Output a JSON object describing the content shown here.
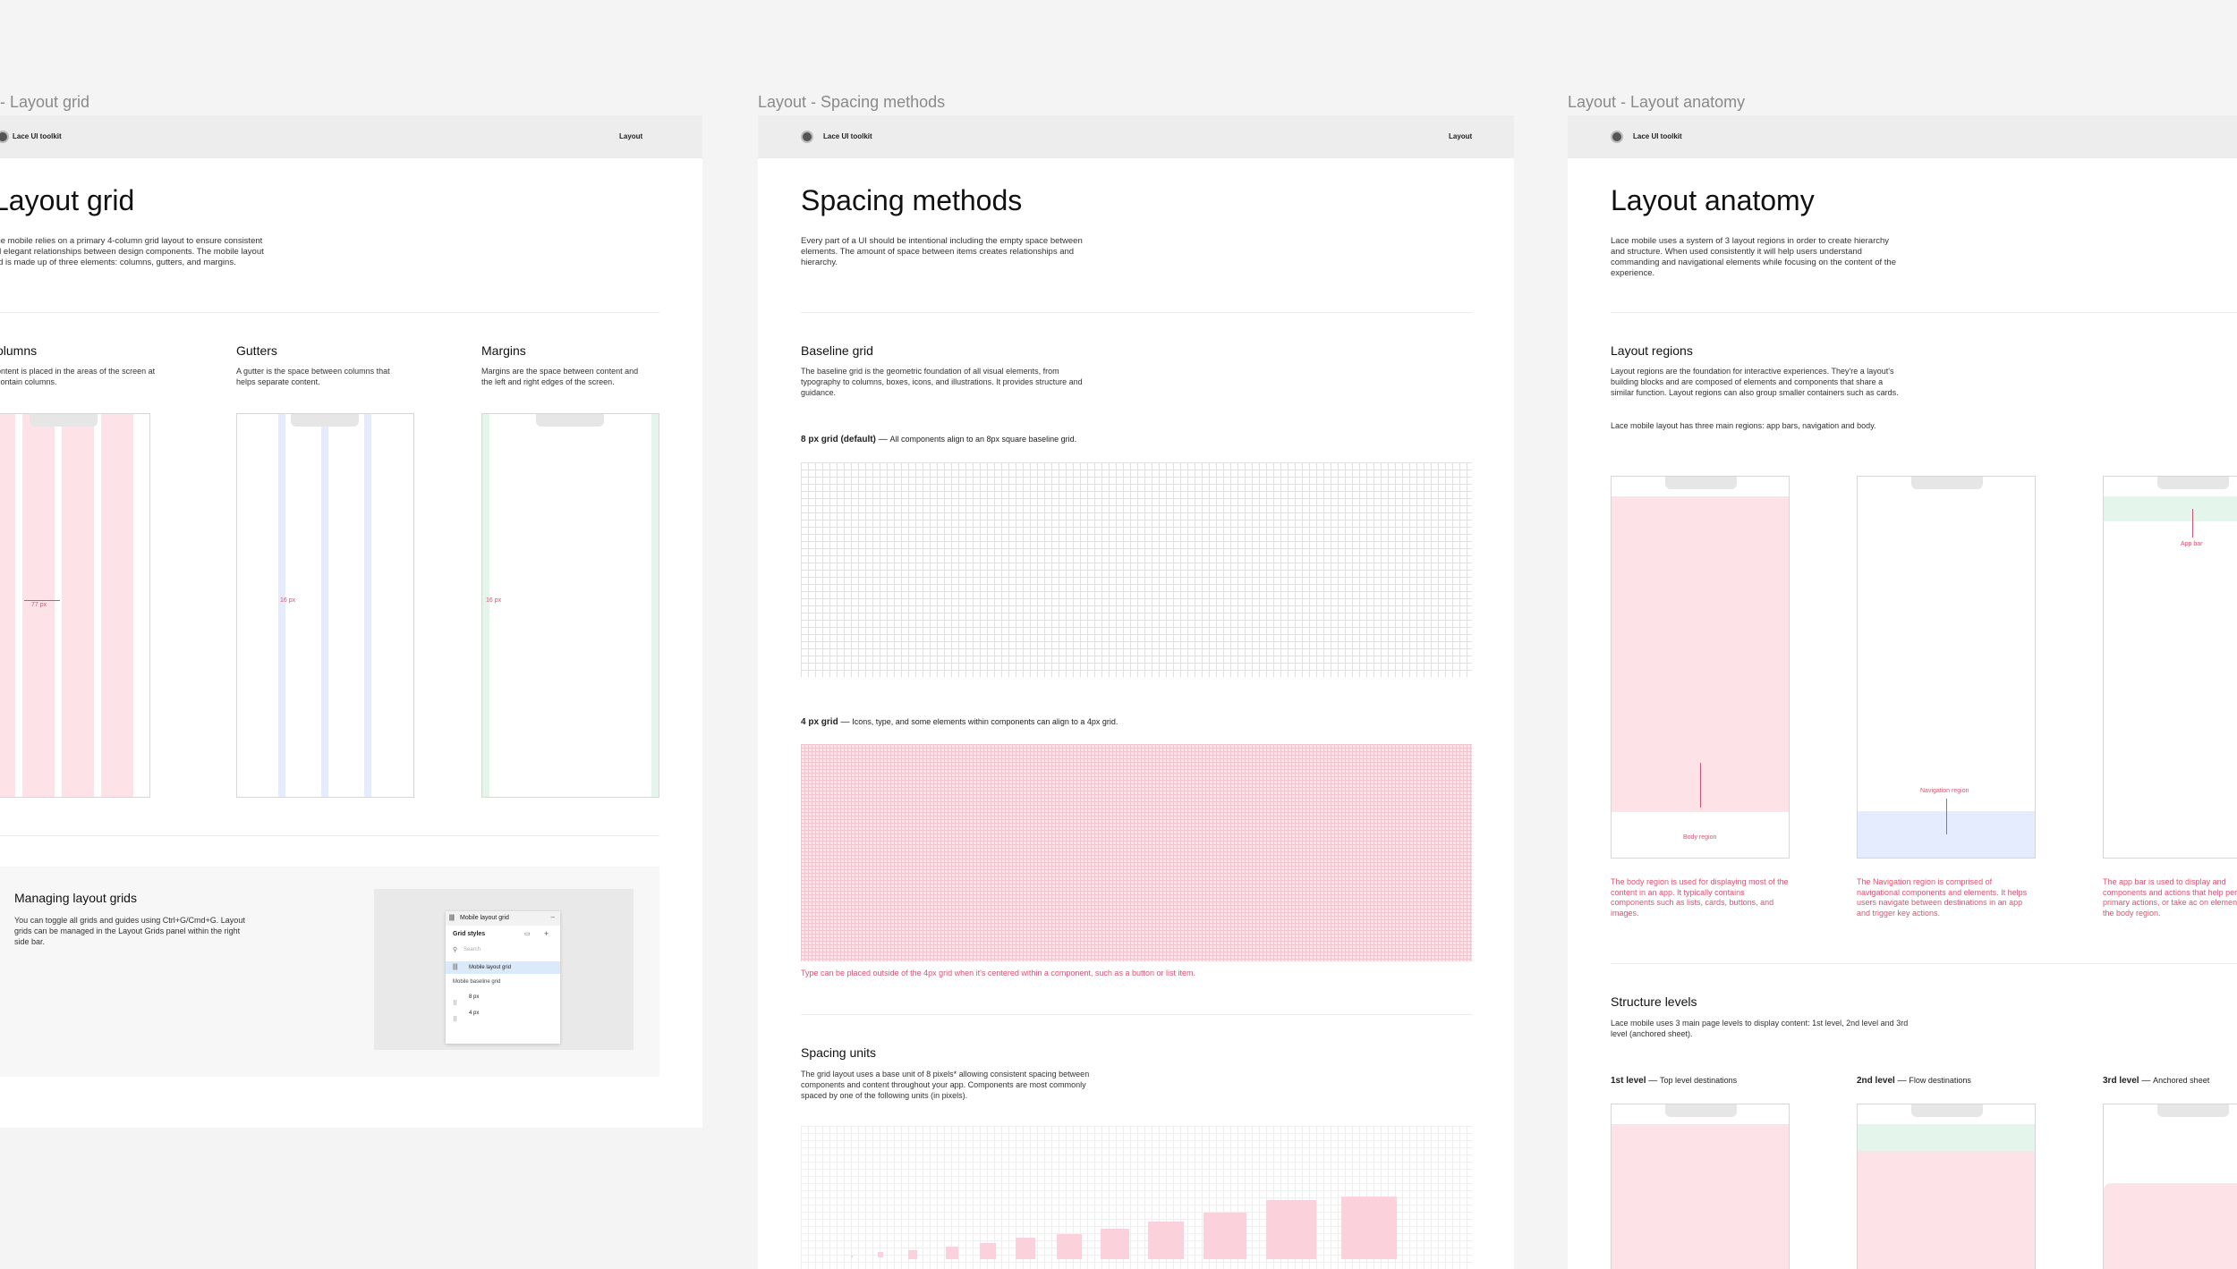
{
  "frames": {
    "layout_grid": {
      "frame_title": "- Layout grid",
      "brand": "Lace UI toolkit",
      "nav": "Layout",
      "title": "Layout grid",
      "intro": "ce mobile relies on a primary 4-column grid layout to ensure consistent d elegant relationships between design components. The mobile layout id is made up of three elements: columns, gutters, and margins.",
      "columns": {
        "heading": "olumns",
        "text": "ontent is placed in the areas of the screen at contain columns.",
        "measure": "77 px"
      },
      "gutters": {
        "heading": "Gutters",
        "text": "A gutter is the space between columns that helps separate content.",
        "measure": "16 px"
      },
      "margins": {
        "heading": "Margins",
        "text": "Margins are the space between content and the left and right edges of the screen.",
        "measure": "16 px"
      },
      "managing": {
        "heading": "Managing layout grids",
        "text": "You can toggle all grids and guides using Ctrl+G/Cmd+G. Layout grids can be managed in the Layout Grids panel within the right side bar.",
        "panel": {
          "header": "Mobile layout grid",
          "section": "Grid styles",
          "search_placeholder": "Search",
          "selected_item": "Mobile layout grid",
          "group_label": "Mobile baseline grid",
          "items": [
            "8 px",
            "4 px"
          ]
        }
      }
    },
    "spacing_methods": {
      "frame_title": "Layout - Spacing methods",
      "brand": "Lace UI toolkit",
      "nav": "Layout",
      "title": "Spacing methods",
      "intro": "Every part of a UI should be intentional including the empty space between elements. The amount of space between items creates relationships and hierarchy.",
      "baseline": {
        "heading": "Baseline grid",
        "text": "The baseline grid is the geometric foundation of all visual elements, from typography to columns, boxes, icons, and illustrations. It provides structure and guidance."
      },
      "grid8": {
        "label": "8 px grid (default)",
        "sep": "—",
        "desc": "All components align to an 8px square baseline grid."
      },
      "grid4": {
        "label": "4 px grid",
        "sep": "—",
        "desc": "Icons, type, and some elements within components can align to a 4px grid."
      },
      "grid4_note": "Type can be placed outside of the 4px grid when it's centered within a component, such as a button or list item.",
      "units": {
        "heading": "Spacing units",
        "text": "The grid layout uses a base unit of 8 pixels* allowing consistent spacing between components and content throughout your app. Components are most commonly spaced by one of the following units (in pixels)."
      }
    },
    "layout_anatomy": {
      "frame_title": "Layout - Layout anatomy",
      "brand": "Lace UI toolkit",
      "title": "Layout anatomy",
      "intro": "Lace mobile uses a system of 3 layout regions in order to create hierarchy and structure. When used consistently it will help users understand commanding and navigational elements while focusing on the content of the experience.",
      "regions": {
        "heading": "Layout regions",
        "text": "Layout regions are the foundation for interactive experiences. They're a layout's building blocks and are composed of elements and components that share a similar function. Layout regions can also group smaller containers such as cards.",
        "text2": "Lace mobile layout has three main regions: app bars, navigation and body.",
        "body_label": "Body region",
        "nav_label": "Navigation region",
        "appbar_label": "App bar",
        "body_note": "The body region is used for displaying most of the content in an app. It typically contains components such as lists, cards, buttons, and images.",
        "nav_note": "The Navigation region is comprised of navigational components and elements. It helps users navigate between destinations in an app and trigger key actions.",
        "appbar_note": "The app bar is used to display and components and actions that help perform primary actions, or take ac on elements in the body region."
      },
      "structure": {
        "heading": "Structure levels",
        "text": "Lace mobile uses 3 main page levels to display content: 1st level, 2nd level and 3rd level (anchored sheet).",
        "levels": [
          {
            "name": "1st level",
            "sep": "—",
            "desc": "Top level destinations"
          },
          {
            "name": "2nd level",
            "sep": "—",
            "desc": "Flow destinations"
          },
          {
            "name": "3rd level",
            "sep": "—",
            "desc": "Anchored sheet"
          }
        ]
      }
    }
  },
  "colors": {
    "column_pink": "#fde3e8",
    "gutter_blue": "#e4ecfd",
    "margin_green": "#e4f5ec",
    "accent_red": "#e0506e"
  }
}
